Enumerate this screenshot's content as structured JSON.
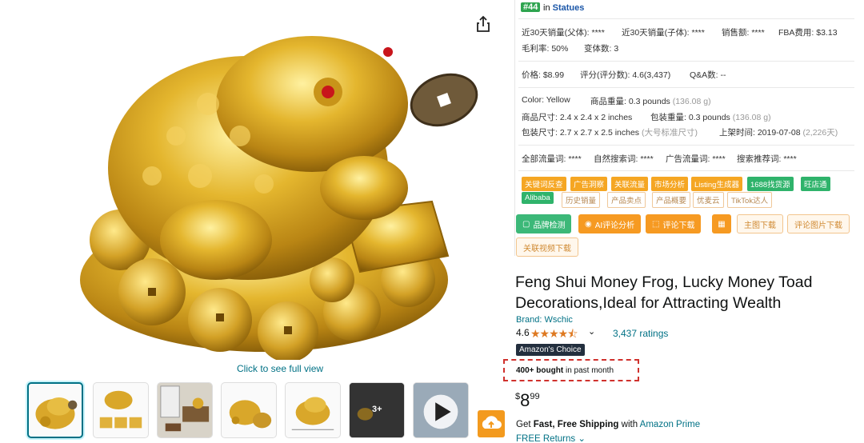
{
  "rank": {
    "number": "#44",
    "in_text": "in",
    "category": "Statues"
  },
  "sales_rows": [
    "近30天销量(父体): ****",
    "近30天销量(子体): ****",
    "销售额: ****",
    "FBA费用: $3.13"
  ],
  "margin_row": [
    "毛利率: 50%",
    "变体数: 3"
  ],
  "price_row": [
    "价格: $8.99",
    "评分(评分数): 4.6(3,437)",
    "Q&A数: --"
  ],
  "attributes": {
    "color_label": "Color:",
    "color_value": "Yellow",
    "item_weight": "商品重量: 0.3 pounds",
    "item_weight_g": "(136.08 g)",
    "item_size": "商品尺寸: 2.4 x 2.4 x 2 inches",
    "pkg_weight": "包装重量: 0.3 pounds",
    "pkg_weight_g": "(136.08 g)",
    "pkg_size": "包装尺寸: 2.7 x 2.7 x 2.5 inches",
    "pkg_size_note": "(大号标准尺寸)",
    "listed": "上架时间: 2019-07-08",
    "listed_days": "(2,226天)"
  },
  "traffic_row": [
    "全部流量词: ****",
    "自然搜索词: ****",
    "广告流量词: ****",
    "搜索推荐词: ****"
  ],
  "tags_row1": [
    "关键词反查",
    "广告洞察",
    "关联流量",
    "市场分析",
    "Listing生成器",
    "1688找货源",
    "旺店通"
  ],
  "tags_row2": [
    "Alibaba",
    "历史销量",
    "产品卖点",
    "产品概要",
    "优麦云",
    "TikTok达人"
  ],
  "buttons": [
    "品牌检测",
    "AI评论分析",
    "评论下载",
    "",
    "主图下载",
    "评论图片下载"
  ],
  "button_extra": "关联视频下载",
  "product": {
    "title": "Feng Shui Money Frog, Lucky Money Toad Decorations,Ideal for Attracting Wealth",
    "brand": "Brand: Wschic",
    "rating": "4.6",
    "stars": "★★★★⯪",
    "ratings_count": "3,437 ratings",
    "choice_badge": "Amazon's Choice",
    "bought_bold": "400+ bought",
    "bought_rest": " in past month",
    "price_symbol": "$",
    "price_whole": "8",
    "price_fraction": "99",
    "ship_get": "Get ",
    "ship_bold": "Fast, Free Shipping",
    "ship_with": " with ",
    "ship_prime": "Amazon Prime",
    "free_returns": "FREE Returns"
  },
  "gallery": {
    "full_view": "Click to see full view",
    "more_count": "3+"
  },
  "colors": {
    "accent_orange": "#f39a1e",
    "link": "#007185",
    "green": "#3cb878",
    "star": "#de7921"
  }
}
